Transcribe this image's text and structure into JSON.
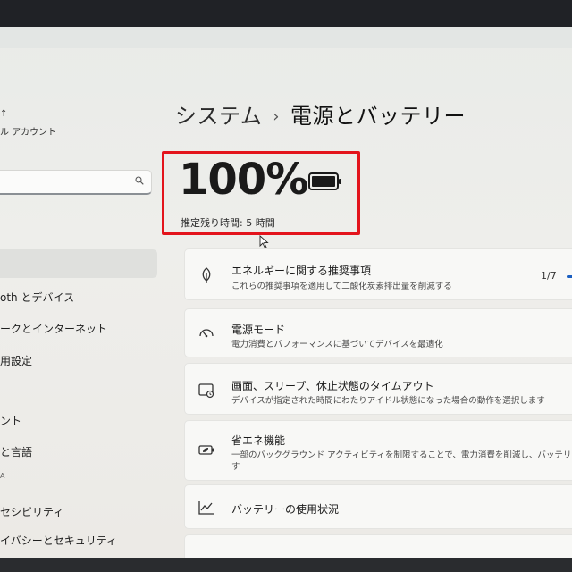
{
  "sidebar": {
    "profile_sub": "ル アカウント",
    "profile_mark": "↑",
    "search_placeholder": "",
    "items": [
      {
        "label": "oth とデバイス"
      },
      {
        "label": "ークとインターネット"
      },
      {
        "label": "用設定"
      },
      {
        "label": "ント"
      },
      {
        "label": "と言語"
      },
      {
        "label": "セシビリティ"
      },
      {
        "label": "イバシーとセキュリティ"
      }
    ],
    "partial_labels": [
      "A"
    ]
  },
  "header": {
    "parent": "システム",
    "separator": "›",
    "current": "電源とバッテリー"
  },
  "battery": {
    "percent_text": "100%",
    "level": 1.0,
    "remaining_text": "推定残り時間: 5 時間"
  },
  "cards": [
    {
      "icon": "leaf-icon",
      "title": "エネルギーに関する推奨事項",
      "desc": "これらの推奨事項を適用して二酸化炭素排出量を削減する",
      "counter": "1/7"
    },
    {
      "icon": "power-mode-icon",
      "title": "電源モード",
      "desc": "電力消費とパフォーマンスに基づいてデバイスを最適化"
    },
    {
      "icon": "screen-sleep-icon",
      "title": "画面、スリープ、休止状態のタイムアウト",
      "desc": "デバイスが指定された時間にわたりアイドル状態になった場合の動作を選択します"
    },
    {
      "icon": "energy-saver-icon",
      "title": "省エネ機能",
      "desc": "一部のバックグラウンド アクティビティを制限することで、電力消費を削減し、バッテリーの寿命を延",
      "desc2": "す"
    },
    {
      "icon": "chart-line-icon",
      "title": "バッテリーの使用状況"
    }
  ],
  "colors": {
    "highlight": "#e3141c",
    "accent": "#1b5fc1"
  }
}
